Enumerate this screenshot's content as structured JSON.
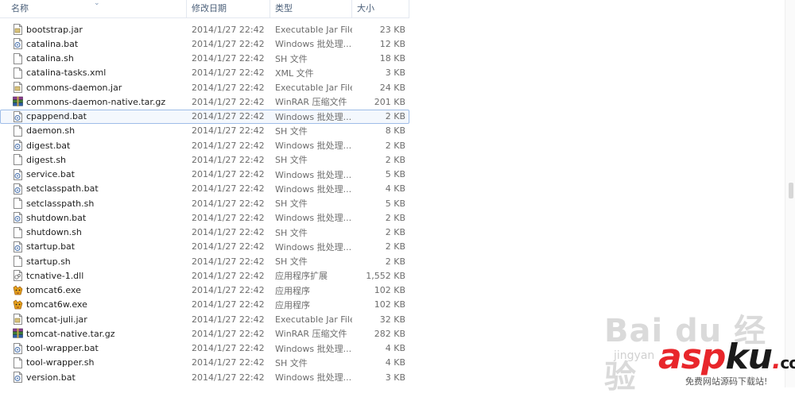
{
  "columns": {
    "name": "名称",
    "date": "修改日期",
    "type": "类型",
    "size": "大小"
  },
  "files": [
    {
      "name": "bootstrap.jar",
      "date": "2014/1/27 22:42",
      "type": "Executable Jar File",
      "size": "23 KB",
      "icon": "jar-file-icon"
    },
    {
      "name": "catalina.bat",
      "date": "2014/1/27 22:42",
      "type": "Windows 批处理...",
      "size": "12 KB",
      "icon": "batch-file-icon"
    },
    {
      "name": "catalina.sh",
      "date": "2014/1/27 22:42",
      "type": "SH 文件",
      "size": "18 KB",
      "icon": "blank-file-icon"
    },
    {
      "name": "catalina-tasks.xml",
      "date": "2014/1/27 22:42",
      "type": "XML 文件",
      "size": "3 KB",
      "icon": "blank-file-icon"
    },
    {
      "name": "commons-daemon.jar",
      "date": "2014/1/27 22:42",
      "type": "Executable Jar File",
      "size": "24 KB",
      "icon": "jar-file-icon"
    },
    {
      "name": "commons-daemon-native.tar.gz",
      "date": "2014/1/27 22:42",
      "type": "WinRAR 压缩文件",
      "size": "201 KB",
      "icon": "winrar-archive-icon"
    },
    {
      "name": "cpappend.bat",
      "date": "2014/1/27 22:42",
      "type": "Windows 批处理...",
      "size": "2 KB",
      "icon": "batch-file-icon"
    },
    {
      "name": "daemon.sh",
      "date": "2014/1/27 22:42",
      "type": "SH 文件",
      "size": "8 KB",
      "icon": "blank-file-icon"
    },
    {
      "name": "digest.bat",
      "date": "2014/1/27 22:42",
      "type": "Windows 批处理...",
      "size": "2 KB",
      "icon": "batch-file-icon"
    },
    {
      "name": "digest.sh",
      "date": "2014/1/27 22:42",
      "type": "SH 文件",
      "size": "2 KB",
      "icon": "blank-file-icon"
    },
    {
      "name": "service.bat",
      "date": "2014/1/27 22:42",
      "type": "Windows 批处理...",
      "size": "5 KB",
      "icon": "batch-file-icon"
    },
    {
      "name": "setclasspath.bat",
      "date": "2014/1/27 22:42",
      "type": "Windows 批处理...",
      "size": "4 KB",
      "icon": "batch-file-icon"
    },
    {
      "name": "setclasspath.sh",
      "date": "2014/1/27 22:42",
      "type": "SH 文件",
      "size": "5 KB",
      "icon": "blank-file-icon"
    },
    {
      "name": "shutdown.bat",
      "date": "2014/1/27 22:42",
      "type": "Windows 批处理...",
      "size": "2 KB",
      "icon": "batch-file-icon"
    },
    {
      "name": "shutdown.sh",
      "date": "2014/1/27 22:42",
      "type": "SH 文件",
      "size": "2 KB",
      "icon": "blank-file-icon"
    },
    {
      "name": "startup.bat",
      "date": "2014/1/27 22:42",
      "type": "Windows 批处理...",
      "size": "2 KB",
      "icon": "batch-file-icon"
    },
    {
      "name": "startup.sh",
      "date": "2014/1/27 22:42",
      "type": "SH 文件",
      "size": "2 KB",
      "icon": "blank-file-icon"
    },
    {
      "name": "tcnative-1.dll",
      "date": "2014/1/27 22:42",
      "type": "应用程序扩展",
      "size": "1,552 KB",
      "icon": "dll-file-icon"
    },
    {
      "name": "tomcat6.exe",
      "date": "2014/1/27 22:42",
      "type": "应用程序",
      "size": "102 KB",
      "icon": "tomcat-exe-icon"
    },
    {
      "name": "tomcat6w.exe",
      "date": "2014/1/27 22:42",
      "type": "应用程序",
      "size": "102 KB",
      "icon": "tomcat-exe-icon"
    },
    {
      "name": "tomcat-juli.jar",
      "date": "2014/1/27 22:42",
      "type": "Executable Jar File",
      "size": "32 KB",
      "icon": "jar-file-icon"
    },
    {
      "name": "tomcat-native.tar.gz",
      "date": "2014/1/27 22:42",
      "type": "WinRAR 压缩文件",
      "size": "282 KB",
      "icon": "winrar-archive-icon"
    },
    {
      "name": "tool-wrapper.bat",
      "date": "2014/1/27 22:42",
      "type": "Windows 批处理...",
      "size": "4 KB",
      "icon": "batch-file-icon"
    },
    {
      "name": "tool-wrapper.sh",
      "date": "2014/1/27 22:42",
      "type": "SH 文件",
      "size": "4 KB",
      "icon": "blank-file-icon"
    },
    {
      "name": "version.bat",
      "date": "2014/1/27 22:42",
      "type": "Windows 批处理...",
      "size": "3 KB",
      "icon": "batch-file-icon"
    }
  ],
  "selected_file": "cpappend.bat",
  "watermark": {
    "baidu": "Bai du 经验",
    "baidu_sub": "jingyan",
    "logo_asp": "asp",
    "logo_ku": "ku",
    "logo_dot": ".",
    "logo_com": "com",
    "tagline": "免费网站源码下载站!"
  },
  "colors": {
    "header_text": "#4c607a",
    "selection_border": "#9fbde8",
    "logo_red": "#e8262b"
  }
}
